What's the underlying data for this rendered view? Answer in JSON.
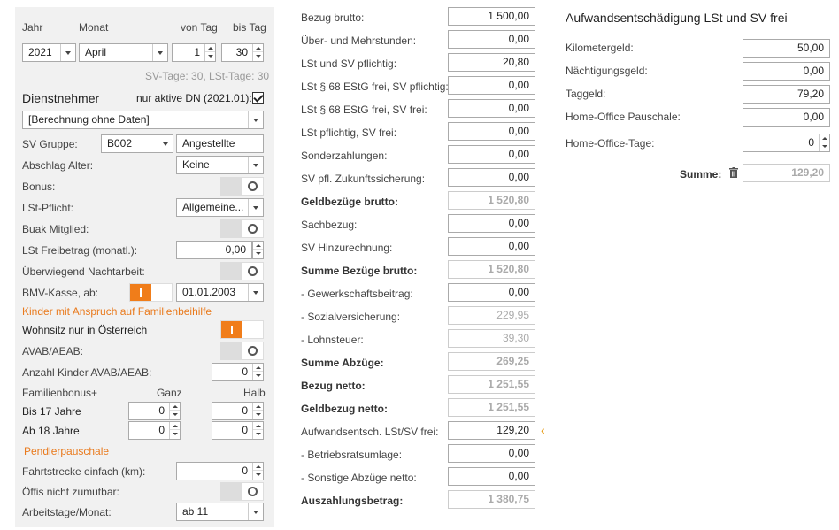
{
  "left": {
    "jahr_label": "Jahr",
    "monat_label": "Monat",
    "von_tag_label": "von Tag",
    "bis_tag_label": "bis Tag",
    "jahr_value": "2021",
    "monat_value": "April",
    "von_tag_value": "1",
    "bis_tag_value": "30",
    "tage_info": "SV-Tage: 30,  LSt-Tage: 30",
    "dienstnehmer_title": "Dienstnehmer",
    "nur_aktive_label": "nur aktive DN (2021.01):",
    "berechnung_value": "[Berechnung ohne Daten]",
    "sv_gruppe_label": "SV Gruppe:",
    "sv_gruppe_code": "B002",
    "sv_gruppe_name": "Angestellte",
    "abschlag_label": "Abschlag Alter:",
    "abschlag_value": "Keine",
    "bonus_label": "Bonus:",
    "lst_pflicht_label": "LSt-Pflicht:",
    "lst_pflicht_value": "Allgemeine...",
    "buak_label": "Buak Mitglied:",
    "lst_freibetrag_label": "LSt Freibetrag (monatl.):",
    "lst_freibetrag_value": "0,00",
    "nachtarbeit_label": "Überwiegend Nachtarbeit:",
    "bmv_label": "BMV-Kasse, ab:",
    "bmv_date": "01.01.2003",
    "kinder_title": "Kinder mit Anspruch auf Familienbeihilfe",
    "wohnsitz_label": "Wohnsitz nur in Österreich",
    "avab_label": "AVAB/AEAB:",
    "anzahl_kinder_label": "Anzahl Kinder AVAB/AEAB:",
    "anzahl_kinder_value": "0",
    "familienbonus_label": "Familienbonus+",
    "ganz_label": "Ganz",
    "halb_label": "Halb",
    "bis17_label": "Bis 17 Jahre",
    "bis17_ganz": "0",
    "bis17_halb": "0",
    "ab18_label": "Ab 18 Jahre",
    "ab18_ganz": "0",
    "ab18_halb": "0",
    "pendler_title": "Pendlerpauschale",
    "fahrtstrecke_label": "Fahrtstrecke einfach (km):",
    "fahrtstrecke_value": "0",
    "oeffis_label": "Öffis nicht zumutbar:",
    "arbeitstage_label": "Arbeitstage/Monat:",
    "arbeitstage_value": "ab 11"
  },
  "middle": {
    "rows": [
      {
        "label": "Bezug brutto:",
        "value": "1 500,00",
        "bold": false,
        "ro": false
      },
      {
        "label": "Über- und Mehrstunden:",
        "value": "0,00",
        "bold": false,
        "ro": false
      },
      {
        "label": "LSt und SV pflichtig:",
        "value": "20,80",
        "bold": false,
        "ro": false
      },
      {
        "label": "LSt § 68 EStG frei, SV pflichtig:",
        "value": "0,00",
        "bold": false,
        "ro": false
      },
      {
        "label": "LSt § 68 EStG frei, SV frei:",
        "value": "0,00",
        "bold": false,
        "ro": false
      },
      {
        "label": "LSt pflichtig, SV frei:",
        "value": "0,00",
        "bold": false,
        "ro": false
      },
      {
        "label": "Sonderzahlungen:",
        "value": "0,00",
        "bold": false,
        "ro": false
      },
      {
        "label": "SV pfl. Zukunftssicherung:",
        "value": "0,00",
        "bold": false,
        "ro": false
      },
      {
        "label": "Geldbezüge brutto:",
        "value": "1 520,80",
        "bold": true,
        "ro": true
      },
      {
        "label": "Sachbezug:",
        "value": "0,00",
        "bold": false,
        "ro": false
      },
      {
        "label": "SV Hinzurechnung:",
        "value": "0,00",
        "bold": false,
        "ro": false
      },
      {
        "label": "Summe Bezüge brutto:",
        "value": "1 520,80",
        "bold": true,
        "ro": true
      },
      {
        "label": "- Gewerkschaftsbeitrag:",
        "value": "0,00",
        "bold": false,
        "ro": false
      },
      {
        "label": "- Sozialversicherung:",
        "value": "229,95",
        "bold": false,
        "ro": true
      },
      {
        "label": "- Lohnsteuer:",
        "value": "39,30",
        "bold": false,
        "ro": true
      },
      {
        "label": "Summe Abzüge:",
        "value": "269,25",
        "bold": true,
        "ro": true
      },
      {
        "label": "Bezug netto:",
        "value": "1 251,55",
        "bold": true,
        "ro": true
      },
      {
        "label": "Geldbezug netto:",
        "value": "1 251,55",
        "bold": true,
        "ro": true
      },
      {
        "label": "Aufwandsentsch. LSt/SV frei:",
        "value": "129,20",
        "bold": false,
        "ro": false
      },
      {
        "label": "- Betriebsratsumlage:",
        "value": "0,00",
        "bold": false,
        "ro": false
      },
      {
        "label": "- Sonstige Abzüge netto:",
        "value": "0,00",
        "bold": false,
        "ro": false
      },
      {
        "label": "Auszahlungsbetrag:",
        "value": "1 380,75",
        "bold": true,
        "ro": true
      }
    ]
  },
  "right": {
    "title": "Aufwandsentschädigung LSt und SV frei",
    "kilometergeld_label": "Kilometergeld:",
    "kilometergeld_value": "50,00",
    "naechtigung_label": "Nächtigungsgeld:",
    "naechtigung_value": "0,00",
    "taggeld_label": "Taggeld:",
    "taggeld_value": "79,20",
    "homeoffice_pauschale_label": "Home-Office Pauschale:",
    "homeoffice_pauschale_value": "0,00",
    "homeoffice_tage_label": "Home-Office-Tage:",
    "homeoffice_tage_value": "0",
    "summe_label": "Summe:",
    "summe_value": "129,20"
  },
  "colors": {
    "accent_orange": "#f07d1a",
    "chevron": "#e8a020"
  }
}
